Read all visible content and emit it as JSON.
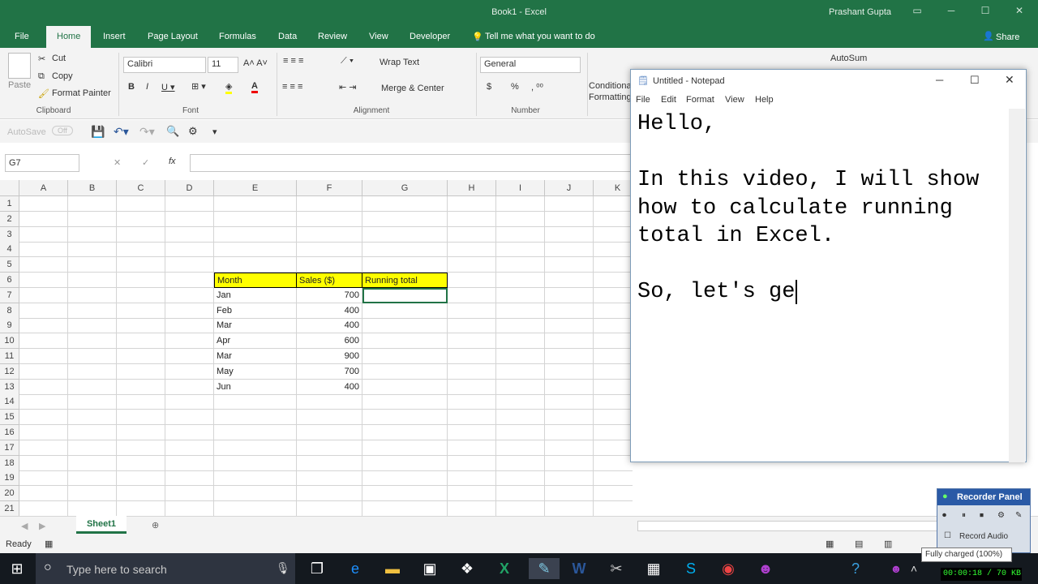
{
  "window": {
    "title": "Book1 - Excel",
    "user": "Prashant Gupta"
  },
  "tabs": [
    "File",
    "Home",
    "Insert",
    "Page Layout",
    "Formulas",
    "Data",
    "Review",
    "View",
    "Developer"
  ],
  "tell_me": "Tell me what you want to do",
  "share": "Share",
  "clipboard": {
    "paste": "Paste",
    "cut": "Cut",
    "copy": "Copy",
    "format_painter": "Format Painter",
    "group": "Clipboard"
  },
  "font": {
    "name": "Calibri",
    "size": "11",
    "group": "Font"
  },
  "alignment": {
    "wrap": "Wrap Text",
    "merge": "Merge & Center",
    "group": "Alignment"
  },
  "number": {
    "format": "General",
    "dollar": "$",
    "percent": "%",
    "group": "Number"
  },
  "styles": {
    "conditional": "Conditional Formatting"
  },
  "editing": {
    "autosum": "AutoSum"
  },
  "qat": {
    "autosave": "AutoSave",
    "autosave_state": "Off"
  },
  "namebox": "G7",
  "columns": [
    "A",
    "B",
    "C",
    "D",
    "E",
    "F",
    "G",
    "H",
    "I",
    "J",
    "K"
  ],
  "rows": [
    "1",
    "2",
    "3",
    "4",
    "5",
    "6",
    "7",
    "8",
    "9",
    "10",
    "11",
    "12",
    "13",
    "14",
    "15",
    "16",
    "17",
    "18",
    "19",
    "20",
    "21"
  ],
  "table": {
    "headers": [
      "Month",
      "Sales ($)",
      "Running total"
    ],
    "rows": [
      [
        "Jan",
        "700"
      ],
      [
        "Feb",
        "400"
      ],
      [
        "Mar",
        "400"
      ],
      [
        "Apr",
        "600"
      ],
      [
        "Mar",
        "900"
      ],
      [
        "May",
        "700"
      ],
      [
        "Jun",
        "400"
      ]
    ]
  },
  "sheet_tab": "Sheet1",
  "status": "Ready",
  "notepad": {
    "title": "Untitled - Notepad",
    "menu": [
      "File",
      "Edit",
      "Format",
      "View",
      "Help"
    ],
    "text": "Hello,\n\nIn this video, I will show how to calculate running total in Excel.\n\nSo, let's ge"
  },
  "recorder": {
    "title": "Recorder Panel",
    "audio": "Record Audio",
    "timer": "00:00:18 / 70 KB"
  },
  "tooltip": "Fully charged (100%)",
  "taskbar": {
    "search": "Type here to search"
  },
  "colors": {
    "excel_green": "#217346",
    "highlight": "#ffff00"
  }
}
